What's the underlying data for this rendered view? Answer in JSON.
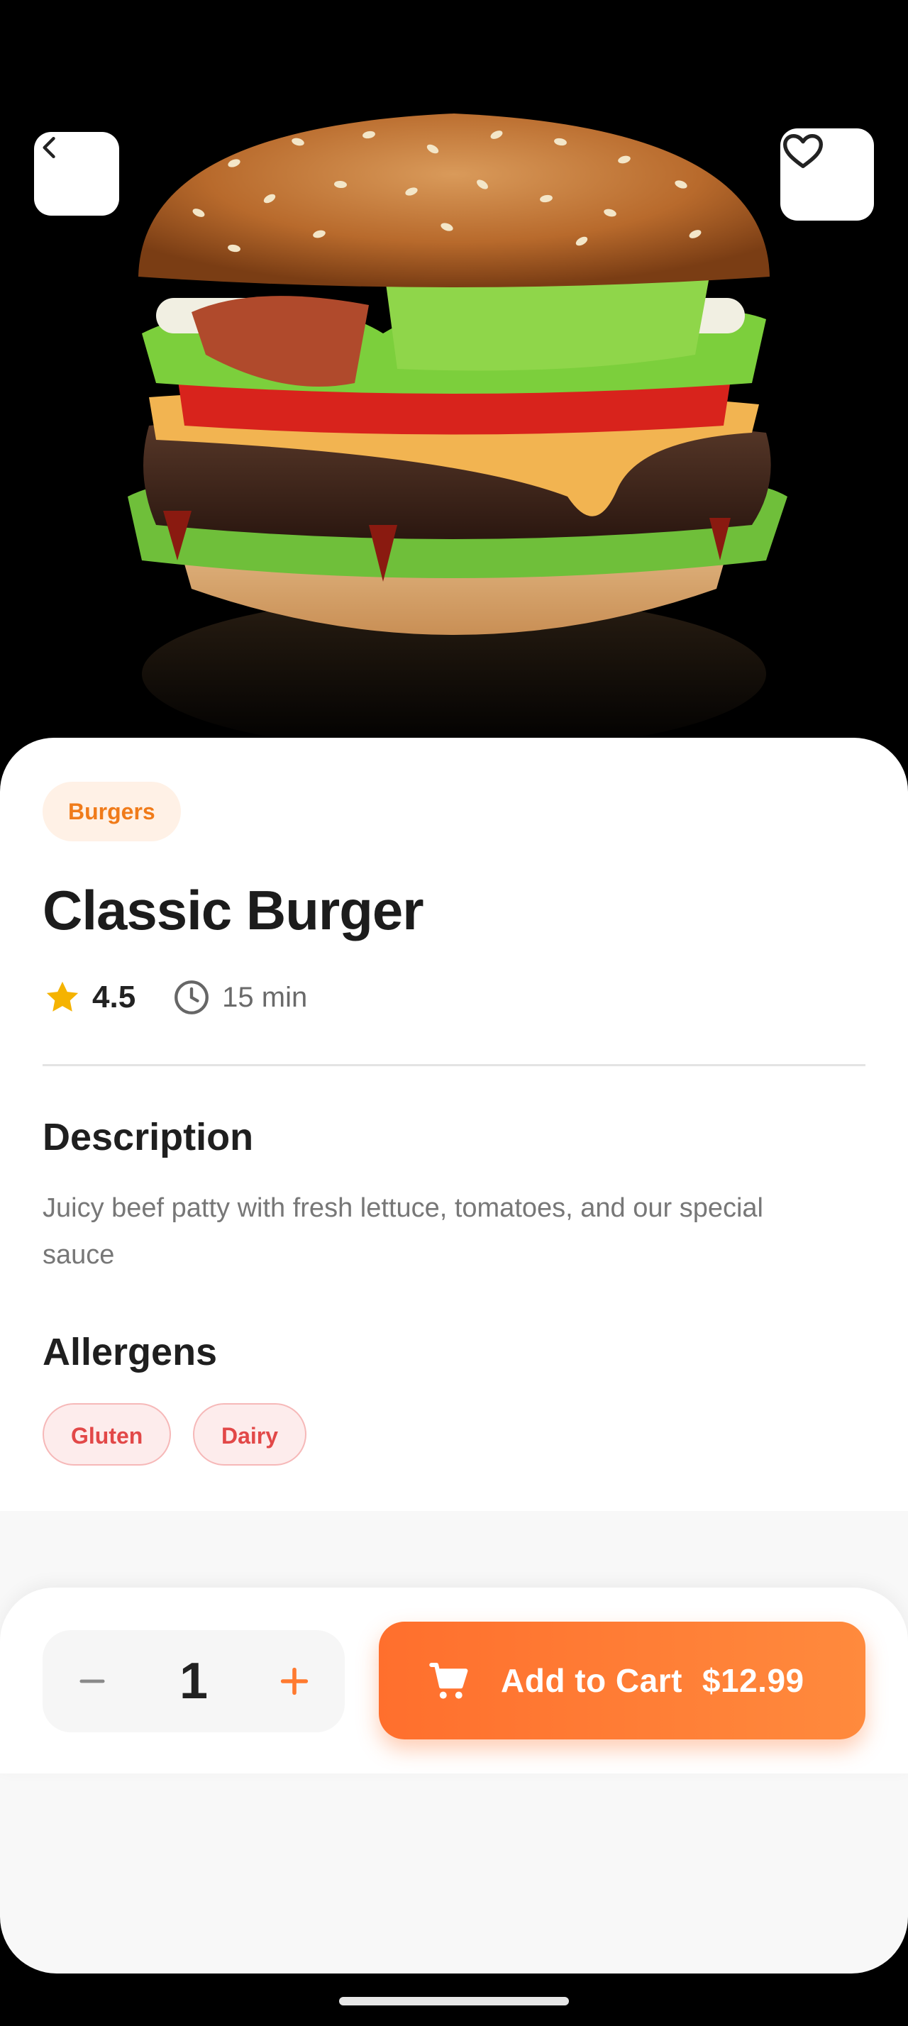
{
  "product": {
    "category": "Burgers",
    "name": "Classic Burger",
    "rating": "4.5",
    "time": "15 min",
    "description_heading": "Description",
    "description": "Juicy beef patty with fresh lettuce, tomatoes, and our special sauce",
    "allergens_heading": "Allergens",
    "allergens": [
      "Gluten",
      "Dairy"
    ]
  },
  "cart": {
    "quantity": "1",
    "add_label": "Add to Cart",
    "price": "$12.99"
  },
  "icons": {
    "back": "chevron-left-icon",
    "favorite": "heart-outline-icon",
    "rating": "star-icon",
    "time": "clock-icon",
    "decrement": "minus-icon",
    "increment": "plus-icon",
    "cart": "shopping-cart-icon"
  },
  "colors": {
    "accent": "#ff7a2f",
    "category_chip_bg": "#fff1e6",
    "category_chip_text": "#f07b1a",
    "allergen_bg": "#fdecec",
    "allergen_text": "#e24848",
    "star": "#f5b301"
  }
}
